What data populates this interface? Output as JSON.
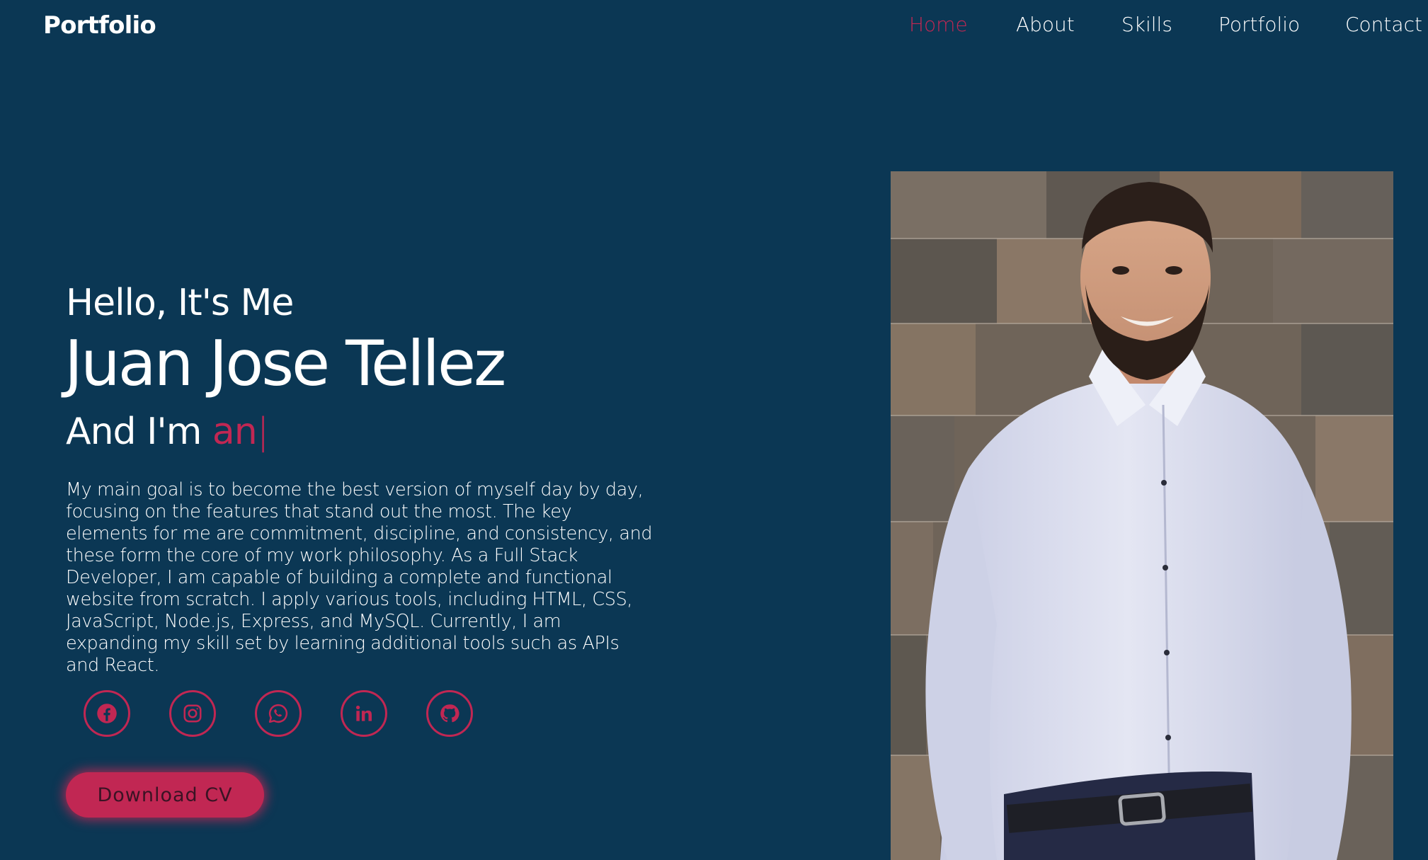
{
  "header": {
    "logo": "Portfolio",
    "nav": [
      {
        "label": "Home",
        "active": true
      },
      {
        "label": "About",
        "active": false
      },
      {
        "label": "Skills",
        "active": false
      },
      {
        "label": "Portfolio",
        "active": false
      },
      {
        "label": "Contact",
        "active": false
      }
    ]
  },
  "hero": {
    "greeting": "Hello, It's Me",
    "name": "Juan Jose Tellez",
    "role_prefix": "And I'm ",
    "role_typed": "an",
    "role_cursor": "|",
    "bio": "My main goal is to become the best version of myself day by day, focusing on the features that stand out the most. The key elements for me are commitment, discipline, and consistency, and these form the core of my work philosophy. As a Full Stack Developer, I am capable of building a complete and functional website from scratch. I apply various tools, including HTML, CSS, JavaScript, Node.js, Express, and MySQL. Currently, I am expanding my skill set by learning additional tools such as APIs and React.",
    "socials": [
      {
        "icon": "facebook-icon"
      },
      {
        "icon": "instagram-icon"
      },
      {
        "icon": "whatsapp-icon"
      },
      {
        "icon": "linkedin-icon"
      },
      {
        "icon": "github-icon"
      }
    ],
    "cv_button": "Download CV"
  },
  "colors": {
    "background": "#0b3754",
    "accent": "#c12753",
    "text": "#ffffff"
  }
}
